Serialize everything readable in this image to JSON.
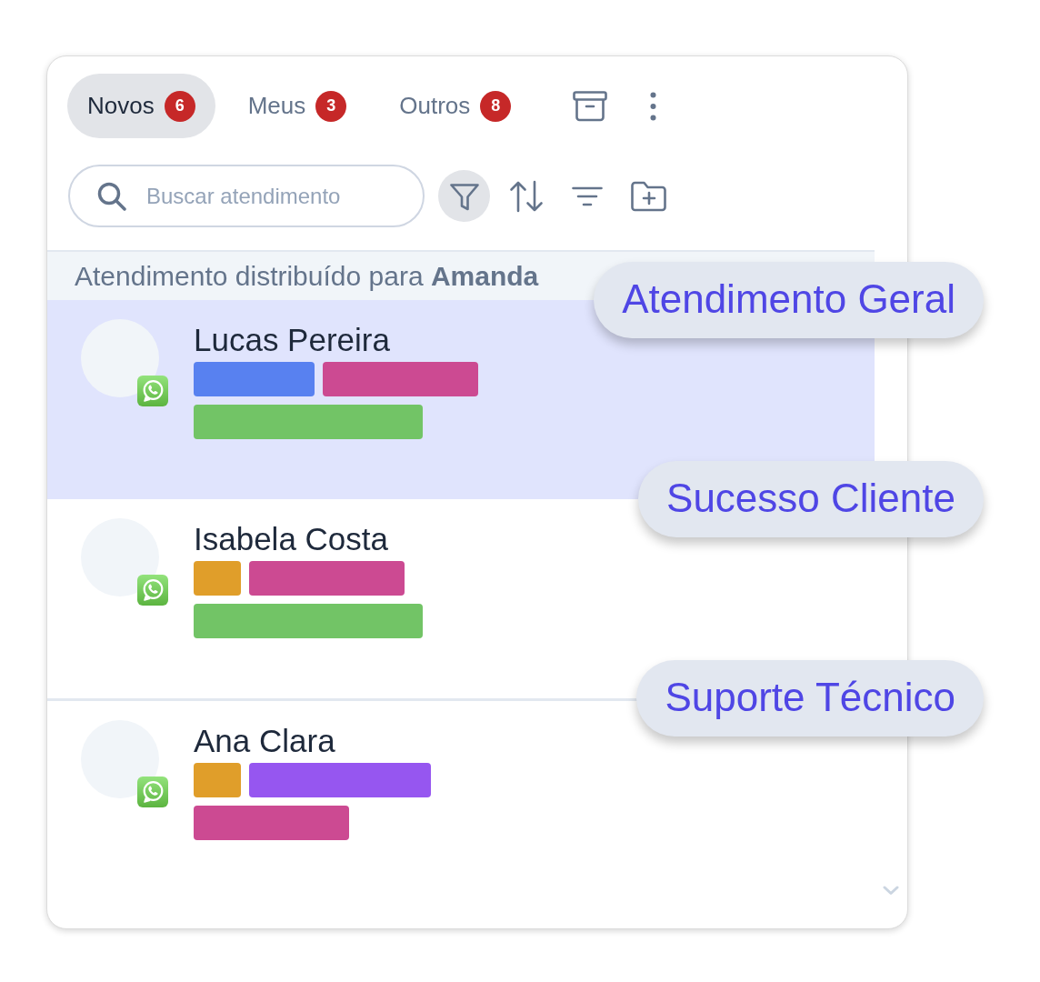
{
  "tabs": [
    {
      "label": "Novos",
      "count": "6",
      "selected": true
    },
    {
      "label": "Meus",
      "count": "3",
      "selected": false
    },
    {
      "label": "Outros",
      "count": "8",
      "selected": false
    }
  ],
  "search": {
    "placeholder": "Buscar atendimento"
  },
  "filter_button": {
    "active": true
  },
  "assignment_notice": "Atendimento distribuído para **Amanda**",
  "conversations": [
    {
      "name": "Lucas Pereira",
      "selected": true,
      "queue": "Atendimento Geral",
      "tags": [
        {
          "kind": "short",
          "color": "#5881f0"
        },
        {
          "kind": "medium",
          "color": "#cc4a92"
        },
        {
          "kind": "long",
          "color": "#72c466"
        }
      ]
    },
    {
      "name": "Isabela Costa",
      "selected": false,
      "queue": "Sucesso Cliente",
      "tags": [
        {
          "kind": "tiny",
          "color": "#e09e2a"
        },
        {
          "kind": "medium",
          "color": "#cc4a92"
        },
        {
          "kind": "long",
          "color": "#72c466"
        }
      ]
    },
    {
      "name": "Ana Clara",
      "selected": false,
      "queue": "Suporte Técnico",
      "tags": [
        {
          "kind": "tiny",
          "color": "#e09e2a"
        },
        {
          "kind": "wide",
          "color": "#9656f0"
        },
        {
          "kind": "medium",
          "color": "#cc4a92"
        }
      ]
    }
  ]
}
